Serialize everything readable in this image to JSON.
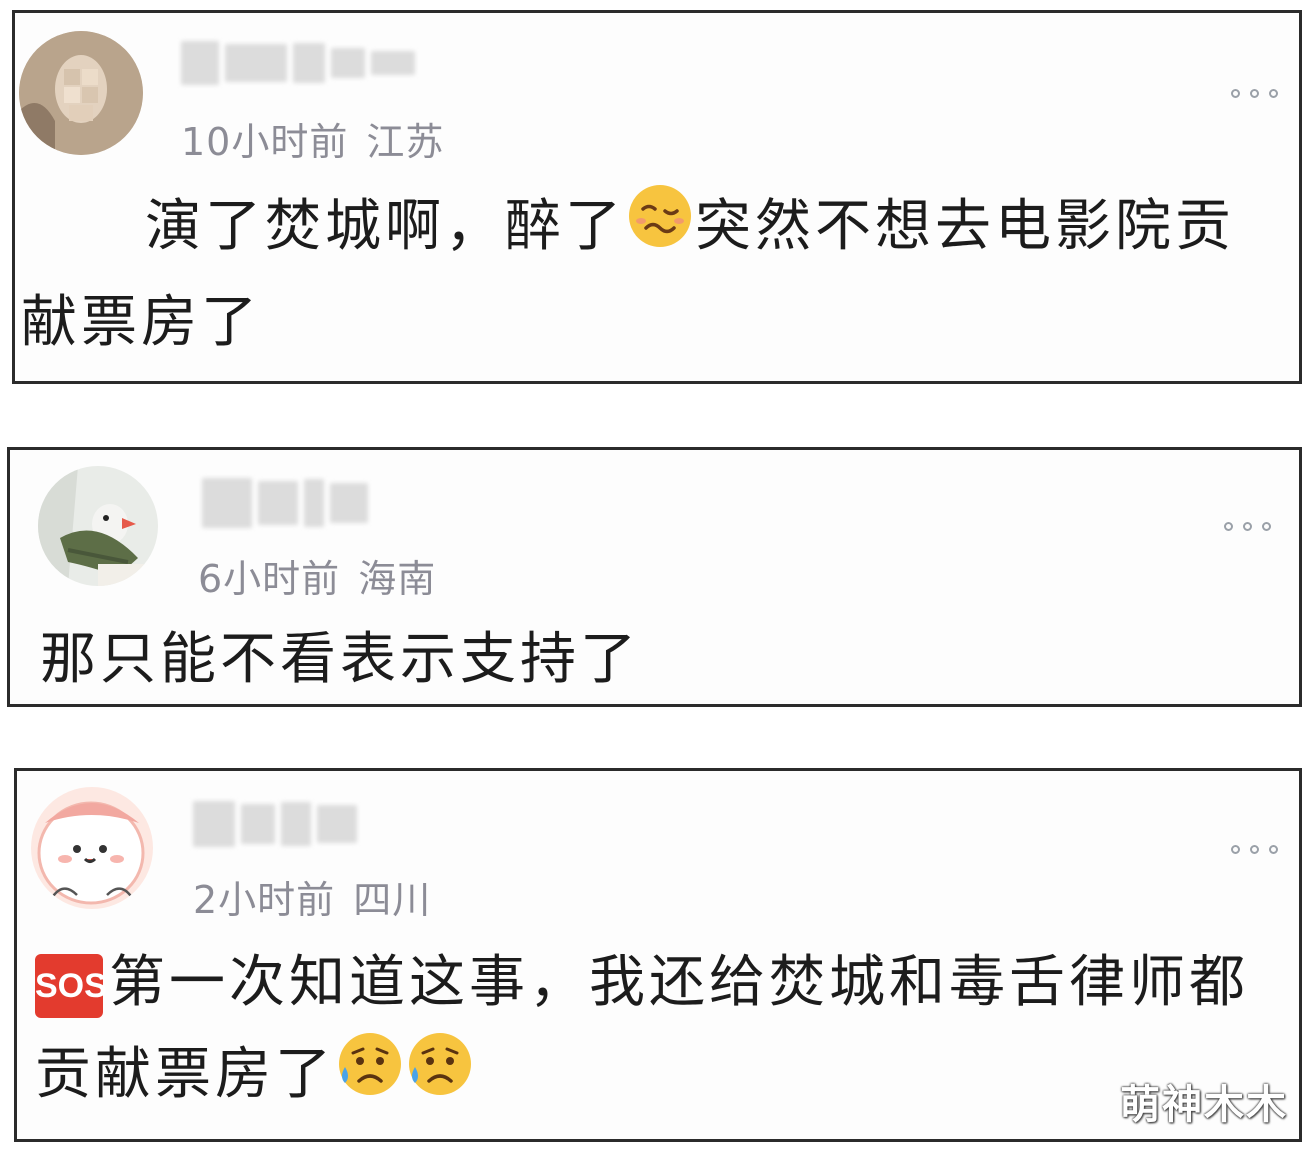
{
  "comments": [
    {
      "time": "10小时前",
      "location": "江苏",
      "text_a": "演了焚城啊，醉了",
      "emoji_a": "woozy-face",
      "text_b": "突然不想去电影院贡",
      "text_c": "献票房了"
    },
    {
      "time": "6小时前",
      "location": "海南",
      "text_a": "那只能不看表示支持了"
    },
    {
      "time": "2小时前",
      "location": "四川",
      "badge": "SOS",
      "text_a": "第一次知道这事，我还给焚城和毒舌律师都",
      "text_b": "贡献票房了",
      "emoji_a": "sad-sweat-face"
    }
  ],
  "watermark": "萌神木木",
  "colors": {
    "meta": "#8c8c96",
    "text": "#1c1c1c",
    "border": "#2b2b2b",
    "sos": "#e33b2e"
  }
}
